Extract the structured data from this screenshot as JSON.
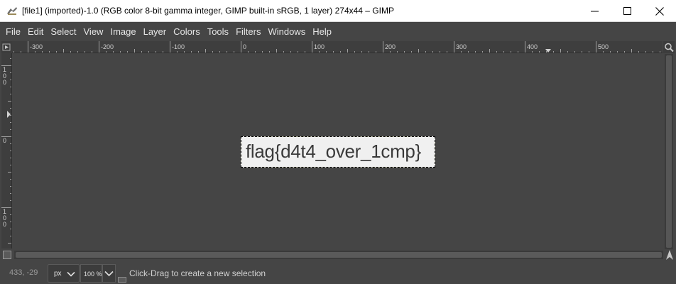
{
  "window": {
    "title": "[file1] (imported)-1.0 (RGB color 8-bit gamma integer, GIMP built-in sRGB, 1 layer) 274x44 – GIMP",
    "app_icon": "gimp-wilber-icon",
    "controls": [
      "minimize-icon",
      "maximize-icon",
      "close-icon"
    ]
  },
  "menubar": {
    "items": [
      "File",
      "Edit",
      "Select",
      "View",
      "Image",
      "Layer",
      "Colors",
      "Tools",
      "Filters",
      "Windows",
      "Help"
    ]
  },
  "rulers": {
    "horizontal_labels": [
      "-300",
      "-200",
      "-100",
      "0",
      "100",
      "200",
      "300",
      "400",
      "500"
    ],
    "vertical_labels": [
      "100",
      "0",
      "100"
    ]
  },
  "canvas": {
    "image_text": "flag{d4t4_over_1cmp}",
    "image_size": "274x44"
  },
  "statusbar": {
    "coords": "433, -29",
    "unit": "px",
    "zoom": "100 %",
    "message": "Click-Drag to create a new selection"
  },
  "colors": {
    "background": "#454545",
    "image_background": "#f0f0f0",
    "selection_border": "#d8d800"
  }
}
